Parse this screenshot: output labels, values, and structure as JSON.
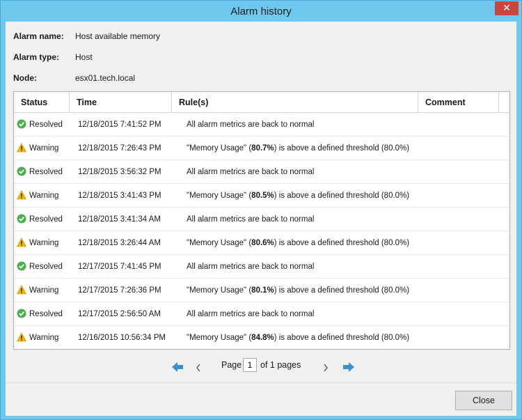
{
  "window": {
    "title": "Alarm history",
    "close_glyph": "✕"
  },
  "fields": {
    "alarm_name_label": "Alarm name:",
    "alarm_name_value": "Host available memory",
    "alarm_type_label": "Alarm type:",
    "alarm_type_value": "Host",
    "node_label": "Node:",
    "node_value": "esx01.tech.local"
  },
  "table": {
    "columns": [
      "Status",
      "Time",
      "Rule(s)",
      "Comment"
    ],
    "rows": [
      {
        "status": "Resolved",
        "icon": "check-circle-icon",
        "time": "12/18/2015 7:41:52 PM",
        "rule_pre": "All alarm metrics are back to normal",
        "rule_bold": "",
        "rule_post": "",
        "comment": ""
      },
      {
        "status": "Warning",
        "icon": "warning-triangle-icon",
        "time": "12/18/2015 7:26:43 PM",
        "rule_pre": "\"Memory Usage\" (",
        "rule_bold": "80.7%",
        "rule_post": ") is above a defined threshold (80.0%)",
        "comment": ""
      },
      {
        "status": "Resolved",
        "icon": "check-circle-icon",
        "time": "12/18/2015 3:56:32 PM",
        "rule_pre": "All alarm metrics are back to normal",
        "rule_bold": "",
        "rule_post": "",
        "comment": ""
      },
      {
        "status": "Warning",
        "icon": "warning-triangle-icon",
        "time": "12/18/2015 3:41:43 PM",
        "rule_pre": "\"Memory Usage\" (",
        "rule_bold": "80.5%",
        "rule_post": ") is above a defined threshold (80.0%)",
        "comment": ""
      },
      {
        "status": "Resolved",
        "icon": "check-circle-icon",
        "time": "12/18/2015 3:41:34 AM",
        "rule_pre": "All alarm metrics are back to normal",
        "rule_bold": "",
        "rule_post": "",
        "comment": ""
      },
      {
        "status": "Warning",
        "icon": "warning-triangle-icon",
        "time": "12/18/2015 3:26:44 AM",
        "rule_pre": "\"Memory Usage\" (",
        "rule_bold": "80.6%",
        "rule_post": ") is above a defined threshold (80.0%)",
        "comment": ""
      },
      {
        "status": "Resolved",
        "icon": "check-circle-icon",
        "time": "12/17/2015 7:41:45 PM",
        "rule_pre": "All alarm metrics are back to normal",
        "rule_bold": "",
        "rule_post": "",
        "comment": ""
      },
      {
        "status": "Warning",
        "icon": "warning-triangle-icon",
        "time": "12/17/2015 7:26:36 PM",
        "rule_pre": "\"Memory Usage\" (",
        "rule_bold": "80.1%",
        "rule_post": ") is above a defined threshold (80.0%)",
        "comment": ""
      },
      {
        "status": "Resolved",
        "icon": "check-circle-icon",
        "time": "12/17/2015 2:56:50 AM",
        "rule_pre": "All alarm metrics are back to normal",
        "rule_bold": "",
        "rule_post": "",
        "comment": ""
      },
      {
        "status": "Warning",
        "icon": "warning-triangle-icon",
        "time": "12/16/2015 10:56:34 PM",
        "rule_pre": "\"Memory Usage\" (",
        "rule_bold": "84.8%",
        "rule_post": ") is above a defined threshold (80.0%)",
        "comment": ""
      }
    ]
  },
  "pager": {
    "page_label": "Page",
    "page_value": "1",
    "of_label": "of 1 pages"
  },
  "buttons": {
    "close_label": "Close"
  },
  "colors": {
    "titlebar": "#6fc9ee",
    "resolved": "#4caf50",
    "warning": "#f5b400",
    "nav_arrow": "#3b8fd1"
  }
}
